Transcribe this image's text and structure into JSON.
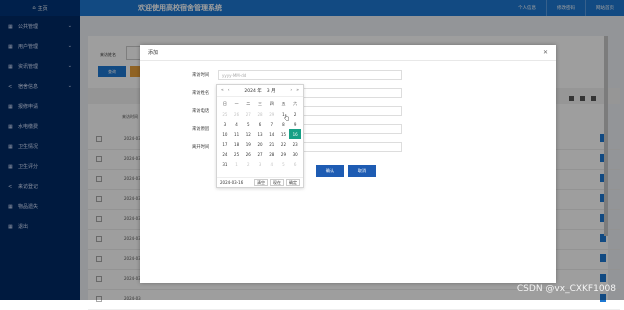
{
  "sidebar": {
    "home_label": "主页",
    "items": [
      {
        "label": "公共管理",
        "icon": "grid-icon",
        "has_chevron": true
      },
      {
        "label": "用户管理",
        "icon": "grid-icon",
        "has_chevron": true
      },
      {
        "label": "资讯管理",
        "icon": "grid-icon",
        "has_chevron": true
      },
      {
        "label": "宿舍信息",
        "icon": "share-icon",
        "has_chevron": true
      },
      {
        "label": "报修申请",
        "icon": "grid-icon",
        "has_chevron": false
      },
      {
        "label": "水电缴费",
        "icon": "grid-icon",
        "has_chevron": false
      },
      {
        "label": "卫生情况",
        "icon": "grid-icon",
        "has_chevron": false
      },
      {
        "label": "卫生评分",
        "icon": "grid-icon",
        "has_chevron": false
      },
      {
        "label": "来访登记",
        "icon": "share-icon",
        "has_chevron": false
      },
      {
        "label": "物品遗失",
        "icon": "grid-icon",
        "has_chevron": false
      },
      {
        "label": "退出",
        "icon": "grid-icon",
        "has_chevron": false
      }
    ]
  },
  "header": {
    "title": "欢迎使用高校宿舍管理系统",
    "links": [
      "个人信息",
      "修改密码",
      "网站首页"
    ]
  },
  "background": {
    "search_label": "来访姓名",
    "query_button": "查询",
    "column_label": "来访时间",
    "row_dates": [
      "2024-03",
      "2024-03",
      "2024-03",
      "2024-03",
      "2024-03",
      "2024-03",
      "2024-03",
      "2024-03",
      "2024-03"
    ]
  },
  "modal": {
    "title": "添加",
    "fields": [
      {
        "label": "来访时间",
        "placeholder": "yyyy-MM-dd"
      },
      {
        "label": "来访姓名",
        "placeholder": ""
      },
      {
        "label": "来访电话",
        "placeholder": ""
      },
      {
        "label": "来访原因",
        "placeholder": ""
      },
      {
        "label": "离开时间",
        "placeholder": ""
      }
    ],
    "confirm_label": "确认",
    "cancel_label": "取消"
  },
  "datepicker": {
    "year": "2024 年",
    "month": "3 月",
    "weekdays": [
      "日",
      "一",
      "二",
      "三",
      "四",
      "五",
      "六"
    ],
    "weeks": [
      [
        "25",
        "26",
        "27",
        "28",
        "29",
        "1",
        "2"
      ],
      [
        "3",
        "4",
        "5",
        "6",
        "7",
        "8",
        "9"
      ],
      [
        "10",
        "11",
        "12",
        "13",
        "14",
        "15",
        "16"
      ],
      [
        "17",
        "18",
        "19",
        "20",
        "21",
        "22",
        "23"
      ],
      [
        "24",
        "25",
        "26",
        "27",
        "28",
        "29",
        "30"
      ],
      [
        "31",
        "1",
        "2",
        "3",
        "4",
        "5",
        "6"
      ]
    ],
    "selected_value": "2024-03-16",
    "clear_label": "清空",
    "now_label": "现在",
    "ok_label": "确定"
  },
  "watermark": "CSDN @vx_CXKF1008",
  "colors": {
    "sidebar_bg": "#002a66",
    "header_bg": "#1e78d2",
    "primary_button": "#1e5cb3",
    "selected_day": "#16a085"
  }
}
